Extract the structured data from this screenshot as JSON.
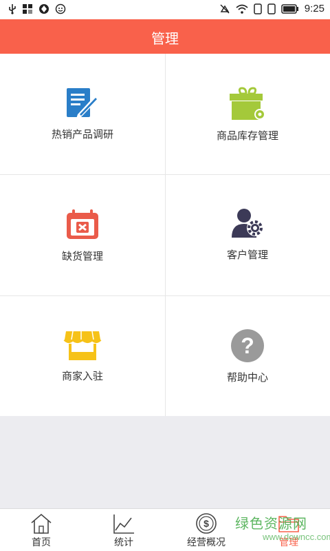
{
  "status_bar": {
    "time": "9:25",
    "left_icons": [
      "usb-icon",
      "apps-icon",
      "sync-icon",
      "emoji-icon"
    ],
    "right_icons": [
      "mute-icon",
      "wifi-icon",
      "sim-icon",
      "sim2-icon",
      "battery-icon"
    ]
  },
  "header": {
    "title": "管理"
  },
  "grid": {
    "items": [
      {
        "label": "热销产品调研",
        "icon": "survey-doc-icon"
      },
      {
        "label": "商品库存管理",
        "icon": "gift-box-gear-icon"
      },
      {
        "label": "缺货管理",
        "icon": "calendar-x-icon"
      },
      {
        "label": "客户管理",
        "icon": "user-gear-icon"
      },
      {
        "label": "商家入驻",
        "icon": "storefront-icon"
      },
      {
        "label": "帮助中心",
        "icon": "help-question-icon"
      }
    ]
  },
  "tabbar": {
    "tabs": [
      {
        "label": "首页",
        "icon": "home-icon"
      },
      {
        "label": "统计",
        "icon": "line-chart-icon"
      },
      {
        "label": "经营概况",
        "icon": "dollar-coin-icon"
      },
      {
        "label": "管理",
        "icon": "folder-icon",
        "active": true
      }
    ]
  },
  "watermark": {
    "text": "绿色资源网",
    "sub": "www.downcc.com"
  },
  "colors": {
    "accent": "#f9614b",
    "background": "#ececf0"
  }
}
